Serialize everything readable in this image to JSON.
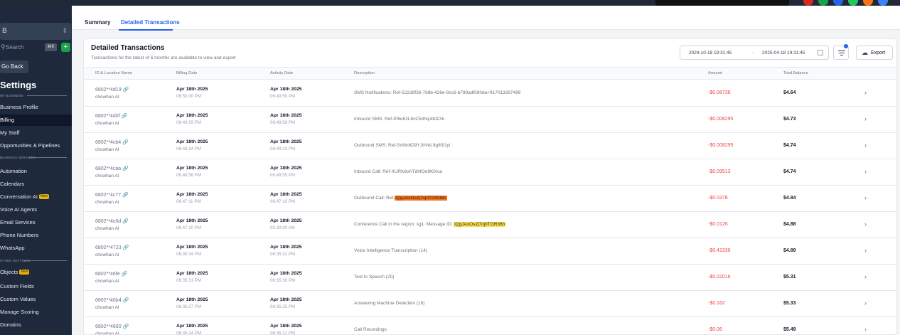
{
  "sidebar": {
    "location_initial": "B",
    "location_toggle": "⇕",
    "search_placeholder": "Search",
    "search_shortcut": "⌘K",
    "add_label": "+",
    "go_back": "Go Back",
    "title": "Settings",
    "sections": [
      {
        "heading": "MY BUSINESS"
      },
      {
        "heading": "BUSINESS SERVICES"
      },
      {
        "heading": "OTHER SETTINGS"
      }
    ],
    "items": [
      {
        "label": "Business Profile"
      },
      {
        "label": "Billing"
      },
      {
        "label": "My Staff"
      },
      {
        "label": "Opportunities & Pipelines"
      },
      {
        "label": "Automation"
      },
      {
        "label": "Calendars"
      },
      {
        "label": "Conversation AI",
        "badge": "New"
      },
      {
        "label": "Voice AI Agents"
      },
      {
        "label": "Email Services"
      },
      {
        "label": "Phone Numbers"
      },
      {
        "label": "WhatsApp"
      },
      {
        "label": "Objects",
        "badge": "New"
      },
      {
        "label": "Custom Fields"
      },
      {
        "label": "Custom Values"
      },
      {
        "label": "Manage Scoring"
      },
      {
        "label": "Domains"
      }
    ]
  },
  "tabs": [
    {
      "label": "Summary"
    },
    {
      "label": "Detailed Transactions"
    }
  ],
  "card": {
    "title": "Detailed Transactions",
    "subtitle": "Transactions for the latest of 6 months are available to view and export",
    "date_from": "2024-10-18 19:31:45",
    "date_to": "2025-04-18 19:31:45",
    "date_arrow": "→",
    "export_icon": "☁",
    "export_label": "Export"
  },
  "columns": {
    "id_location": "ID & Location Name",
    "billing_date": "Billing Date",
    "activity_date": "Activity Date",
    "description": "Description",
    "amount": "Amount",
    "total_balance": "Total Balance"
  },
  "link_icon": "🔗",
  "chevron": "›",
  "rows": [
    {
      "id": "6802**4d19",
      "location": "chowhan AI",
      "billing_date": "Apr 18th 2025",
      "billing_time": "06:50:00 PM",
      "activity_date": "Apr 18th 2025",
      "activity_time": "06:49:59 PM",
      "description": "SMS Notifications: Ref-522d9f36-768b-426e-9cc6-b799adf590da+917013397489",
      "amount": "-$0.08736",
      "balance": "$4.64"
    },
    {
      "id": "6802**4d0f",
      "location": "chowhan AI",
      "billing_date": "Apr 18th 2025",
      "billing_time": "06:49:59 PM",
      "activity_date": "Apr 18th 2025",
      "activity_time": "06:49:58 PM",
      "description": "Inbound SMS: Ref-IP6e62LbvC54hqJdd1Xk",
      "amount": "-$0.008295",
      "balance": "$4.73"
    },
    {
      "id": "6802**4cb4",
      "location": "chowhan AI",
      "billing_date": "Apr 18th 2025",
      "billing_time": "06:49:24 PM",
      "activity_date": "Apr 18th 2025",
      "activity_time": "06:49:23 PM",
      "description": "Outbound SMS: Ref-SoNn6D9YJbVeL9g85Gyi",
      "amount": "-$0.008295",
      "balance": "$4.74"
    },
    {
      "id": "6802**4caa",
      "location": "chowhan AI",
      "billing_date": "Apr 18th 2025",
      "billing_time": "06:48:56 PM",
      "activity_date": "Apr 18th 2025",
      "activity_time": "06:48:55 PM",
      "description": "Inbound Call: Ref-XURfv6xhTdhfOe9KlXsa",
      "amount": "-$0.09513",
      "balance": "$4.74"
    },
    {
      "id": "6802**4c77",
      "location": "chowhan AI",
      "billing_date": "Apr 18th 2025",
      "billing_time": "06:47:11 PM",
      "activity_date": "Apr 18th 2025",
      "activity_time": "06:47:10 PM",
      "description": "Outbound Call: Ref-",
      "highlight": "iQgJAxOs2j7nj0TGR36h",
      "highlight_color": "#f97316",
      "amount": "-$0.0378",
      "balance": "$4.84"
    },
    {
      "id": "6802**4c6d",
      "location": "chowhan AI",
      "billing_date": "Apr 18th 2025",
      "billing_time": "06:47:10 PM",
      "activity_date": "Apr 18th 2025",
      "activity_time": "05:30:00 AM",
      "description": "Conference Call in the region: sg1. Message ID: ",
      "highlight": "iQgJAxOs2j7nj0TGR36h",
      "highlight_color": "#fde047",
      "amount": "-$0.0126",
      "balance": "$4.88"
    },
    {
      "id": "6802**4723",
      "location": "chowhan AI",
      "billing_date": "Apr 18th 2025",
      "billing_time": "06:35:34 PM",
      "activity_date": "Apr 18th 2025",
      "activity_time": "06:35:32 PM",
      "description": "Voice Intelligence Transcription (14)",
      "amount": "-$0.42336",
      "balance": "$4.89"
    },
    {
      "id": "6802**46fe",
      "location": "chowhan AI",
      "billing_date": "Apr 18th 2025",
      "billing_time": "06:35:31 PM",
      "activity_date": "Apr 18th 2025",
      "activity_time": "06:35:30 PM",
      "description": "Text to Speech (20)",
      "amount": "-$0.02016",
      "balance": "$5.31"
    },
    {
      "id": "6802**46b4",
      "location": "chowhan AI",
      "billing_date": "Apr 18th 2025",
      "billing_time": "06:35:27 PM",
      "activity_date": "Apr 18th 2025",
      "activity_time": "06:35:25 PM",
      "description": "Answering Machine Detection (18)",
      "amount": "-$0.162",
      "balance": "$5.33"
    },
    {
      "id": "6802**4690",
      "location": "chowhan AI",
      "billing_date": "Apr 18th 2025",
      "billing_time": "06:35:24 PM",
      "activity_date": "Apr 18th 2025",
      "activity_time": "06:35:21 PM",
      "description": "Call Recordings",
      "amount": "-$0.06",
      "balance": "$5.49"
    }
  ],
  "colors": {
    "accent": "#2563eb",
    "sidebar_bg": "#1e293b",
    "amount_negative": "#ef4444",
    "browser_icons": [
      "#dc2626",
      "#16a34a",
      "#2563eb",
      "#22c55e",
      "#f97316",
      "#3b82f6"
    ]
  }
}
